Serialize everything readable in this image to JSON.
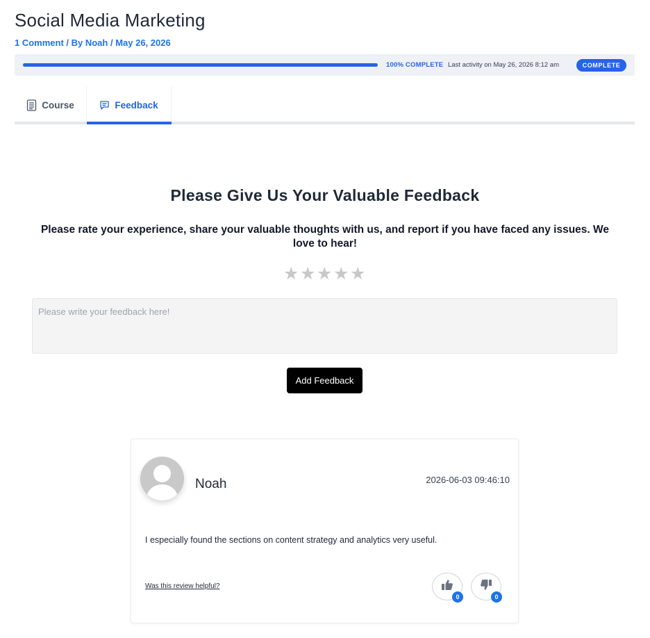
{
  "header": {
    "title": "Social Media Marketing",
    "meta": "1 Comment / By Noah / May 26, 2026"
  },
  "progress": {
    "percent": 100,
    "label": "100% COMPLETE",
    "last_activity": "Last activity on May 26, 2026 8:12 am",
    "badge": "COMPLETE",
    "accent_color": "#2563eb"
  },
  "tabs": [
    {
      "label": "Course",
      "icon": "document-icon",
      "active": false
    },
    {
      "label": "Feedback",
      "icon": "chat-bubble-icon",
      "active": true
    }
  ],
  "feedback_form": {
    "heading": "Please Give Us Your Valuable Feedback",
    "subheading": "Please rate your experience, share your valuable thoughts with us, and report if you have faced any issues. We love to hear!",
    "rating": {
      "max": 5,
      "value": 0,
      "icon": "star-icon"
    },
    "input_placeholder": "Please write your feedback here!",
    "input_value": "",
    "submit_label": "Add Feedback"
  },
  "review": {
    "name": "Noah",
    "date": "2026-06-03 09:46:10",
    "text": "I especially found the sections on content strategy and analytics very useful.",
    "helpful_label": "Was this review helpful?",
    "likes": "0",
    "dislikes": "0",
    "icons": {
      "avatar": "user-avatar-icon",
      "like": "thumbs-up-icon",
      "dislike": "thumbs-down-icon"
    }
  }
}
